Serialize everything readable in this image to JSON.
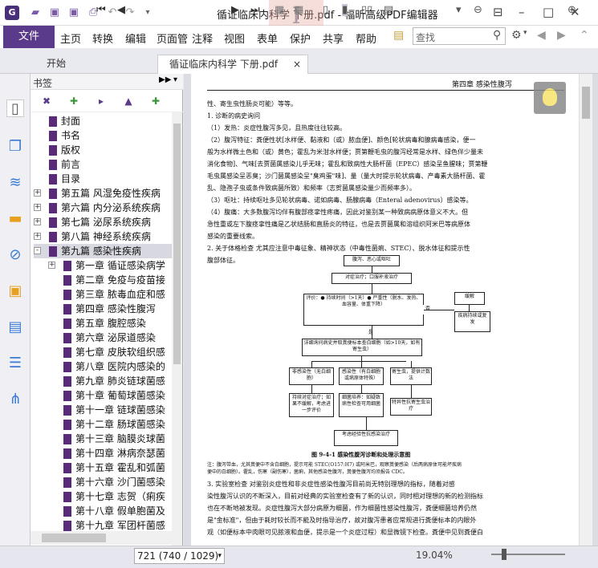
{
  "window": {
    "title": "循证临床内科学 下册.pdf - 福昕高级PDF编辑器"
  },
  "ribbon": {
    "file": "文件",
    "menus": [
      "主页",
      "转换",
      "编辑",
      "页面管",
      "注释",
      "视图",
      "表单",
      "保护",
      "共享",
      "帮助"
    ],
    "search_placeholder": "查找"
  },
  "tabs": [
    {
      "label": "开始"
    },
    {
      "label": "循证临床内科学 下册.pdf"
    }
  ],
  "bookmarks": {
    "header": "书签",
    "items": [
      {
        "label": "封面",
        "level": 1,
        "expand": ""
      },
      {
        "label": "书名",
        "level": 1,
        "expand": ""
      },
      {
        "label": "版权",
        "level": 1,
        "expand": ""
      },
      {
        "label": "前言",
        "level": 1,
        "expand": ""
      },
      {
        "label": "目录",
        "level": 1,
        "expand": ""
      },
      {
        "label": "第五篇 风湿免疫性疾病",
        "level": 1,
        "expand": "+"
      },
      {
        "label": "第六篇 内分泌系统疾病",
        "level": 1,
        "expand": "+"
      },
      {
        "label": "第七篇 泌尿系统疾病",
        "level": 1,
        "expand": "+"
      },
      {
        "label": "第八篇 神经系统疾病",
        "level": 1,
        "expand": "+"
      },
      {
        "label": "第九篇 感染性疾病",
        "level": 1,
        "expand": "-",
        "selected": true
      },
      {
        "label": "第一章 循证感染病学",
        "level": 2,
        "expand": "+"
      },
      {
        "label": "第二章 免疫与疫苗接",
        "level": 2,
        "expand": ""
      },
      {
        "label": "第三章 脓毒血症和感",
        "level": 2,
        "expand": ""
      },
      {
        "label": "第四章 感染性腹泻",
        "level": 2,
        "expand": ""
      },
      {
        "label": "第五章 腹腔感染",
        "level": 2,
        "expand": ""
      },
      {
        "label": "第六章 泌尿道感染",
        "level": 2,
        "expand": ""
      },
      {
        "label": "第七章 皮肤软组织感",
        "level": 2,
        "expand": ""
      },
      {
        "label": "第八章 医院内感染的",
        "level": 2,
        "expand": ""
      },
      {
        "label": "第九章 肺炎链球菌感",
        "level": 2,
        "expand": ""
      },
      {
        "label": "第十章 葡萄球菌感染",
        "level": 2,
        "expand": ""
      },
      {
        "label": "第十一章 链球菌感染",
        "level": 2,
        "expand": ""
      },
      {
        "label": "第十二章 肠球菌感染",
        "level": 2,
        "expand": ""
      },
      {
        "label": "第十三章 脑膜炎球菌",
        "level": 2,
        "expand": ""
      },
      {
        "label": "第十四章 淋病奈瑟菌",
        "level": 2,
        "expand": ""
      },
      {
        "label": "第十五章 霍乱和弧菌",
        "level": 2,
        "expand": ""
      },
      {
        "label": "第十六章 沙门菌感染",
        "level": 2,
        "expand": ""
      },
      {
        "label": "第十七章 志贺（痢疾",
        "level": 2,
        "expand": ""
      },
      {
        "label": "第十八章 假单胞菌及",
        "level": 2,
        "expand": ""
      },
      {
        "label": "第十九章 军团杆菌感",
        "level": 2,
        "expand": ""
      }
    ]
  },
  "document": {
    "header": "第四章 感染性腹泻",
    "paragraphs": [
      "性、寄生虫性肠炎可能）等等。",
      "1. 诊断的病史询问",
      "（1）发热：炎症性腹泻多见，且热度往往较高。",
      "（2）腹泻特征：粪便性状[水样便、黏液和（或）脓血便]、颜色[轮状病毒和腺病毒感染，便一",
      "般为水样微土色和（或）黄色；霍乱为米泔水样便；贾第鞭毛虫的腹泻经常是水样、绿色伴少量未",
      "消化食物]、气味[去贾菌属感染儿乎无味；霍乱和致病性大肠杆菌（EPEC）感染呈鱼腥味；贾第鞭",
      "毛虫属感染呈恶臭；沙门菌属感染呈\"臭鸡蛋\"味]、量（量大时提示轮状病毒、产毒素大肠杆菌、霍",
      "乱、隐孢子虫或条件致病菌所致）和频率（志贺菌属感染量少而频率多）。",
      "（3）呕吐：持续呕吐多见轮状病毒、诺如病毒、肠腺病毒（Enteral adenovirus）感染等。",
      "（4）腹痛：大多数腹泻均伴有腹部痉挛性疼痛，因此对鉴别某一种致病病原体意义不大。但",
      "急性重或左下腹痉挛性痛是乙状结肠和直肠炎的特征，也是去贾菌属和溶组织阿米巴等病原体",
      "感染的重要线索。",
      "2. 关于体格检查 尤其应注意中毒征象、精神状态（中毒性菌痢、STEC）、脱水体征和提示性",
      "腹部体征。"
    ],
    "flow": [
      "腹泻、恶心或呕吐",
      "对症治疗；口服补液治疗",
      "评价：● 持续时间（>1天）● 严重性（脱水、发热、血容量、体重下降）",
      "否",
      "缓解",
      "疾病持续或复发",
      "是",
      "详细询问病史并取粪便标本查白细胞（如>10天，如有寄生虫）",
      "非感染性（无白细胞）",
      "感染性（有白细胞或病原体特殊）",
      "寄生虫，提供计数法",
      "持续对症治疗；如果不缓解，考虑进一步评价",
      "细菌培养：如疑致病性检查可用细菌",
      "特异性抗寄生虫治疗",
      "考虑经验性抗感染治疗"
    ],
    "caption": "图 9-4-1 感染性腹泻诊断和处理示意图",
    "notes": [
      "注：腹泻带血，尤其粪便中不含白细胞，提示可能 STEC(O157:H7) 或阿米巴，观察粪便感染（后两病原体可能坏疾病",
      "便中的白细胞）。霍乱，伤寒（副伤寒），菌痢，其他感染性腹泻，粪便性腹泻均须报告 CDC。"
    ],
    "paragraphs2": [
      "3. 实验室检查 对鉴别炎症性和非炎症性感染性腹泻目前尚无特别理想的指标，随着对感",
      "染性腹泻认识的不断深入，目前对经典的实验室检查有了新的认识，同时相对理想的新的检测指标",
      "也在不断地被发现。炎症性腹泻大部分病原为细菌，作为细菌性感染性腹泻，粪便细菌培养仍然",
      "是\"金标准\"，但由于耗时较长而不能及时指导治疗，故对腹泻患者应常规进行粪便标本的内眼外",
      "观（如便标本中肉眼可见脓液和血便，提示是一个炎症过程）和显微镜下检查。粪便中见到粪便白"
    ]
  },
  "statusbar": {
    "page": "721 (740 / 1029)",
    "zoom": "19.04%"
  }
}
